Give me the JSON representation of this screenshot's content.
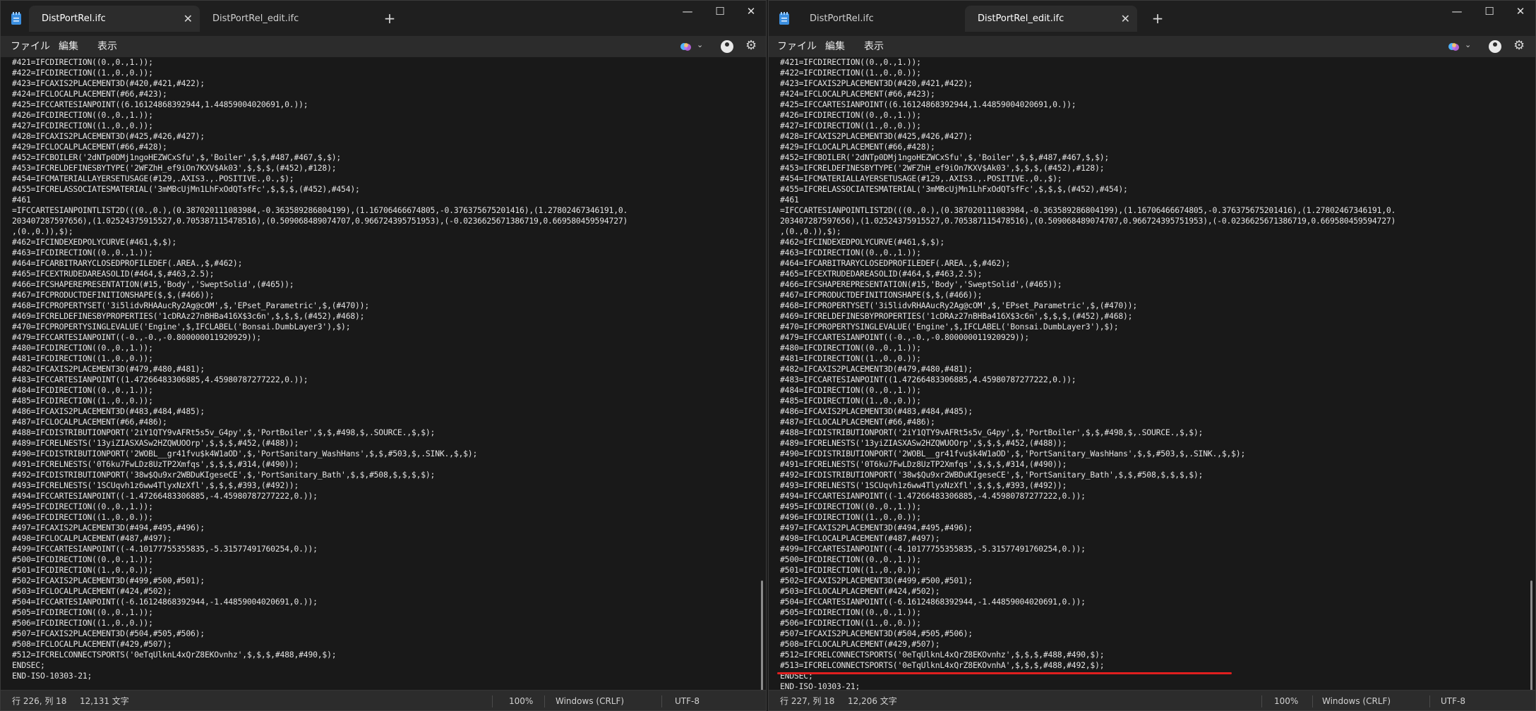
{
  "left": {
    "tabs": [
      "DistPortRel.ifc",
      "DistPortRel_edit.ifc"
    ],
    "menu": [
      "ファイル",
      "編集",
      "表示"
    ],
    "lines": [
      "#421=IFCDIRECTION((0.,0.,1.));",
      "#422=IFCDIRECTION((1.,0.,0.));",
      "#423=IFCAXIS2PLACEMENT3D(#420,#421,#422);",
      "#424=IFCLOCALPLACEMENT(#66,#423);",
      "#425=IFCCARTESIANPOINT((6.16124868392944,1.44859004020691,0.));",
      "#426=IFCDIRECTION((0.,0.,1.));",
      "#427=IFCDIRECTION((1.,0.,0.));",
      "#428=IFCAXIS2PLACEMENT3D(#425,#426,#427);",
      "#429=IFCLOCALPLACEMENT(#66,#428);",
      "#452=IFCBOILER('2dNTp0DMj1ngoHEZWCxSfu',$,'Boiler',$,$,#487,#467,$,$);",
      "#453=IFCRELDEFINESBYTYPE('2WFZhH_ef9iOn7KXV$Ak03',$,$,$,(#452),#128);",
      "#454=IFCMATERIALLAYERSETUSAGE(#129,.AXIS3.,.POSITIVE.,0.,$);",
      "#455=IFCRELASSOCIATESMATERIAL('3mMBcUjMn1LhFxOdQTsfFc',$,$,$,(#452),#454);",
      "#461",
      "=IFCCARTESIANPOINTLIST2D(((0.,0.),(0.387020111083984,-0.363589286804199),(1.16706466674805,-0.376375675201416),(1.27802467346191,0.",
      "203407287597656),(1.02524375915527,0.705387115478516),(0.509068489074707,0.966724395751953),(-0.0236625671386719,0.669580459594727)",
      ",(0.,0.)),$);",
      "#462=IFCINDEXEDPOLYCURVE(#461,$,$);",
      "#463=IFCDIRECTION((0.,0.,1.));",
      "#464=IFCARBITRARYCLOSEDPROFILEDEF(.AREA.,$,#462);",
      "#465=IFCEXTRUDEDAREASOLID(#464,$,#463,2.5);",
      "#466=IFCSHAPEREPRESENTATION(#15,'Body','SweptSolid',(#465));",
      "#467=IFCPRODUCTDEFINITIONSHAPE($,$,(#466));",
      "#468=IFCPROPERTYSET('3i5lidvRHAAucRy2Ag@cOM',$,'EPset_Parametric',$,(#470));",
      "#469=IFCRELDEFINESBYPROPERTIES('1cDRAz27nBHBa416X$3c6n',$,$,$,(#452),#468);",
      "#470=IFCPROPERTYSINGLEVALUE('Engine',$,IFCLABEL('Bonsai.DumbLayer3'),$);",
      "#479=IFCCARTESIANPOINT((-0.,-0.,-0.800000011920929));",
      "#480=IFCDIRECTION((0.,0.,1.));",
      "#481=IFCDIRECTION((1.,0.,0.));",
      "#482=IFCAXIS2PLACEMENT3D(#479,#480,#481);",
      "#483=IFCCARTESIANPOINT((1.47266483306885,4.45980787277222,0.));",
      "#484=IFCDIRECTION((0.,0.,1.));",
      "#485=IFCDIRECTION((1.,0.,0.));",
      "#486=IFCAXIS2PLACEMENT3D(#483,#484,#485);",
      "#487=IFCLOCALPLACEMENT(#66,#486);",
      "#488=IFCDISTRIBUTIONPORT('2iY1QTY9vAFRt5s5v_G4py',$,'PortBoiler',$,$,#498,$,.SOURCE.,$,$);",
      "#489=IFCRELNESTS('13yiZIASXASw2HZQWUOOrp',$,$,$,#452,(#488));",
      "#490=IFCDISTRIBUTIONPORT('2WOBL__gr41fvu$k4W1aOD',$,'PortSanitary_WashHans',$,$,#503,$,.SINK.,$,$);",
      "#491=IFCRELNESTS('0T6ku7FwLDz8UzTP2Xmfqs',$,$,$,#314,(#490));",
      "#492=IFCDISTRIBUTIONPORT('38w$Qu9xr2WBDuKIgeseCE',$,'PortSanitary_Bath',$,$,#508,$,$,$,$);",
      "#493=IFCRELNESTS('1SCUqvh1z6ww4TlyxNzXfl',$,$,$,#393,(#492));",
      "#494=IFCCARTESIANPOINT((-1.47266483306885,-4.45980787277222,0.));",
      "#495=IFCDIRECTION((0.,0.,1.));",
      "#496=IFCDIRECTION((1.,0.,0.));",
      "#497=IFCAXIS2PLACEMENT3D(#494,#495,#496);",
      "#498=IFCLOCALPLACEMENT(#487,#497);",
      "#499=IFCCARTESIANPOINT((-4.10177755355835,-5.31577491760254,0.));",
      "#500=IFCDIRECTION((0.,0.,1.));",
      "#501=IFCDIRECTION((1.,0.,0.));",
      "#502=IFCAXIS2PLACEMENT3D(#499,#500,#501);",
      "#503=IFCLOCALPLACEMENT(#424,#502);",
      "#504=IFCCARTESIANPOINT((-6.16124868392944,-1.44859004020691,0.));",
      "#505=IFCDIRECTION((0.,0.,1.));",
      "#506=IFCDIRECTION((1.,0.,0.));",
      "#507=IFCAXIS2PLACEMENT3D(#504,#505,#506);",
      "#508=IFCLOCALPLACEMENT(#429,#507);",
      "#512=IFCRELCONNECTSPORTS('0eTqUlknL4xQrZ8EKOvnhz',$,$,$,#488,#490,$);",
      "ENDSEC;",
      "END-ISO-10303-21;"
    ],
    "status": {
      "position": "行 226, 列 18",
      "chars": "12,131 文字",
      "zoom": "100%",
      "line_ending": "Windows (CRLF)",
      "encoding": "UTF-8"
    }
  },
  "right": {
    "tabs": [
      "DistPortRel.ifc",
      "DistPortRel_edit.ifc"
    ],
    "menu": [
      "ファイル",
      "編集",
      "表示"
    ],
    "lines": [
      "#421=IFCDIRECTION((0.,0.,1.));",
      "#422=IFCDIRECTION((1.,0.,0.));",
      "#423=IFCAXIS2PLACEMENT3D(#420,#421,#422);",
      "#424=IFCLOCALPLACEMENT(#66,#423);",
      "#425=IFCCARTESIANPOINT((6.16124868392944,1.44859004020691,0.));",
      "#426=IFCDIRECTION((0.,0.,1.));",
      "#427=IFCDIRECTION((1.,0.,0.));",
      "#428=IFCAXIS2PLACEMENT3D(#425,#426,#427);",
      "#429=IFCLOCALPLACEMENT(#66,#428);",
      "#452=IFCBOILER('2dNTp0DMj1ngoHEZWCxSfu',$,'Boiler',$,$,#487,#467,$,$);",
      "#453=IFCRELDEFINESBYTYPE('2WFZhH_ef9iOn7KXV$Ak03',$,$,$,(#452),#128);",
      "#454=IFCMATERIALLAYERSETUSAGE(#129,.AXIS3.,.POSITIVE.,0.,$);",
      "#455=IFCRELASSOCIATESMATERIAL('3mMBcUjMn1LhFxOdQTsfFc',$,$,$,(#452),#454);",
      "#461",
      "=IFCCARTESIANPOINTLIST2D(((0.,0.),(0.387020111083984,-0.363589286804199),(1.16706466674805,-0.376375675201416),(1.27802467346191,0.",
      "203407287597656),(1.02524375915527,0.705387115478516),(0.509068489074707,0.966724395751953),(-0.0236625671386719,0.669580459594727)",
      ",(0.,0.)),$);",
      "#462=IFCINDEXEDPOLYCURVE(#461,$,$);",
      "#463=IFCDIRECTION((0.,0.,1.));",
      "#464=IFCARBITRARYCLOSEDPROFILEDEF(.AREA.,$,#462);",
      "#465=IFCEXTRUDEDAREASOLID(#464,$,#463,2.5);",
      "#466=IFCSHAPEREPRESENTATION(#15,'Body','SweptSolid',(#465));",
      "#467=IFCPRODUCTDEFINITIONSHAPE($,$,(#466));",
      "#468=IFCPROPERTYSET('3i5lidvRHAAucRy2Ag@cOM',$,'EPset_Parametric',$,(#470));",
      "#469=IFCRELDEFINESBYPROPERTIES('1cDRAz27nBHBa416X$3c6n',$,$,$,(#452),#468);",
      "#470=IFCPROPERTYSINGLEVALUE('Engine',$,IFCLABEL('Bonsai.DumbLayer3'),$);",
      "#479=IFCCARTESIANPOINT((-0.,-0.,-0.800000011920929));",
      "#480=IFCDIRECTION((0.,0.,1.));",
      "#481=IFCDIRECTION((1.,0.,0.));",
      "#482=IFCAXIS2PLACEMENT3D(#479,#480,#481);",
      "#483=IFCCARTESIANPOINT((1.47266483306885,4.45980787277222,0.));",
      "#484=IFCDIRECTION((0.,0.,1.));",
      "#485=IFCDIRECTION((1.,0.,0.));",
      "#486=IFCAXIS2PLACEMENT3D(#483,#484,#485);",
      "#487=IFCLOCALPLACEMENT(#66,#486);",
      "#488=IFCDISTRIBUTIONPORT('2iY1QTY9vAFRt5s5v_G4py',$,'PortBoiler',$,$,#498,$,.SOURCE.,$,$);",
      "#489=IFCRELNESTS('13yiZIASXASw2HZQWUOOrp',$,$,$,#452,(#488));",
      "#490=IFCDISTRIBUTIONPORT('2WOBL__gr41fvu$k4W1aOD',$,'PortSanitary_WashHans',$,$,#503,$,.SINK.,$,$);",
      "#491=IFCRELNESTS('0T6ku7FwLDz8UzTP2Xmfqs',$,$,$,#314,(#490));",
      "#492=IFCDISTRIBUTIONPORT('38w$Qu9xr2WBDuKIgeseCE',$,'PortSanitary_Bath',$,$,#508,$,$,$,$);",
      "#493=IFCRELNESTS('1SCUqvh1z6ww4TlyxNzXfl',$,$,$,#393,(#492));",
      "#494=IFCCARTESIANPOINT((-1.47266483306885,-4.45980787277222,0.));",
      "#495=IFCDIRECTION((0.,0.,1.));",
      "#496=IFCDIRECTION((1.,0.,0.));",
      "#497=IFCAXIS2PLACEMENT3D(#494,#495,#496);",
      "#498=IFCLOCALPLACEMENT(#487,#497);",
      "#499=IFCCARTESIANPOINT((-4.10177755355835,-5.31577491760254,0.));",
      "#500=IFCDIRECTION((0.,0.,1.));",
      "#501=IFCDIRECTION((1.,0.,0.));",
      "#502=IFCAXIS2PLACEMENT3D(#499,#500,#501);",
      "#503=IFCLOCALPLACEMENT(#424,#502);",
      "#504=IFCCARTESIANPOINT((-6.16124868392944,-1.44859004020691,0.));",
      "#505=IFCDIRECTION((0.,0.,1.));",
      "#506=IFCDIRECTION((1.,0.,0.));",
      "#507=IFCAXIS2PLACEMENT3D(#504,#505,#506);",
      "#508=IFCLOCALPLACEMENT(#429,#507);",
      "#512=IFCRELCONNECTSPORTS('0eTqUlknL4xQrZ8EKOvnhz',$,$,$,#488,#490,$);",
      "#513=IFCRELCONNECTSPORTS('0eTqUlknL4xQrZ8EKOvnhA',$,$,$,#488,#492,$);",
      "ENDSEC;",
      "END-ISO-10303-21;"
    ],
    "status": {
      "position": "行 227, 列 18",
      "chars": "12,206 文字",
      "zoom": "100%",
      "line_ending": "Windows (CRLF)",
      "encoding": "UTF-8"
    }
  },
  "colors": {
    "background": "#1c1c1c",
    "editor": "#191919",
    "bar": "#2c2c2c",
    "text": "#e4e4e4",
    "highlight": "#e01f1f",
    "app_icon": "#3b8fe0"
  },
  "icons": [
    "notepad-app-icon",
    "close-icon",
    "plus-icon",
    "minimize-icon",
    "maximize-icon",
    "copilot-icon",
    "chevron-down-icon",
    "account-icon",
    "gear-icon"
  ]
}
